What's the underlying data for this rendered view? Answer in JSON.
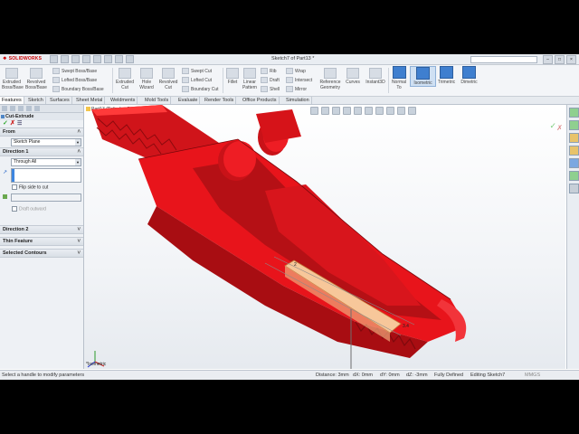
{
  "app": {
    "logo": "SOLIDWORKS",
    "title": "Sketch7 of Part13 *"
  },
  "ribbon": {
    "extruded_boss": "Extruded Boss/Base",
    "revolved_boss": "Revolved Boss/Base",
    "swept_boss": "Swept Boss/Base",
    "lofted_boss": "Lofted Boss/Base",
    "boundary_boss": "Boundary Boss/Base",
    "extruded_cut": "Extruded Cut",
    "hole_wizard": "Hole Wizard",
    "revolved_cut": "Revolved Cut",
    "swept_cut": "Swept Cut",
    "lofted_cut": "Lofted Cut",
    "boundary_cut": "Boundary Cut",
    "fillet": "Fillet",
    "linear_pattern": "Linear Pattern",
    "rib": "Rib",
    "draft": "Draft",
    "shell": "Shell",
    "wrap": "Wrap",
    "intersect": "Intersect",
    "mirror": "Mirror",
    "reference_geometry": "Reference Geometry",
    "curves": "Curves",
    "instant3d": "Instant3D",
    "normal_to": "Normal To",
    "isometric": "Isometric",
    "trimetric": "Trimetric",
    "dimetric": "Dimetric"
  },
  "tabs": [
    "Features",
    "Sketch",
    "Surfaces",
    "Sheet Metal",
    "Weldments",
    "Mold Tools",
    "Evaluate",
    "Render Tools",
    "Office Products",
    "Simulation"
  ],
  "panel": {
    "feature_title": "Cut-Extrude",
    "from_label": "From",
    "from_value": "Sketch Plane",
    "direction1_label": "Direction 1",
    "end_condition": "Through All",
    "flip_side": "Flip side to cut",
    "draft_outward": "Draft outward",
    "direction2_label": "Direction 2",
    "thin_feature_label": "Thin Feature",
    "selected_contours_label": "Selected Contours"
  },
  "viewport": {
    "tree_item": "Part13  (Default<<Def",
    "view_label": "*Isometric",
    "model_color": "#e8141b"
  },
  "status": {
    "message": "Select a handle to modify parameters",
    "distance": "Distance: 3mm",
    "dx": "dX: 0mm",
    "dy": "dY: 0mm",
    "dz": "dZ: -3mm",
    "state": "Fully Defined",
    "editing": "Editing Sketch7",
    "units": "MMGS"
  }
}
